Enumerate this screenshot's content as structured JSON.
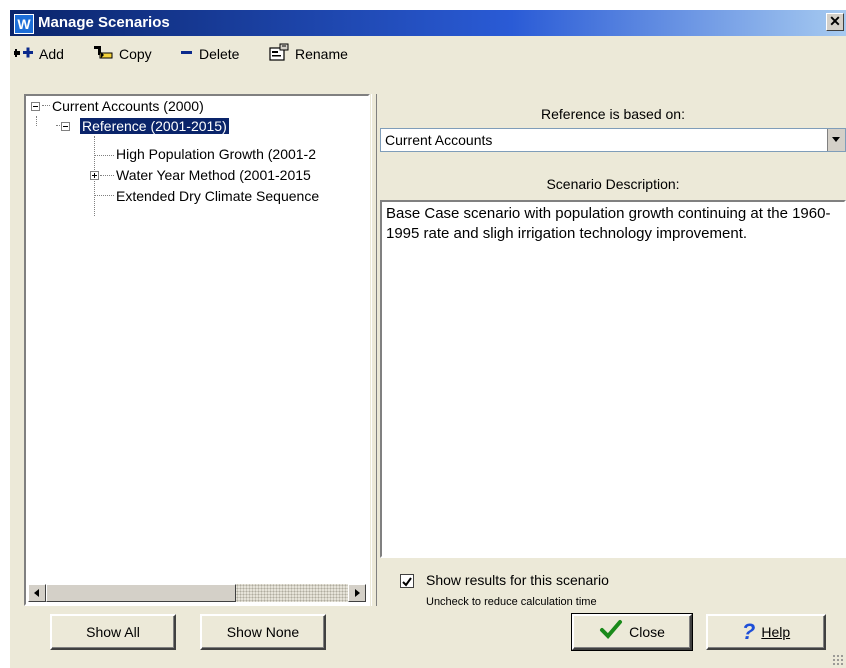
{
  "window": {
    "title": "Manage Scenarios",
    "app_icon_letter": "W",
    "close_glyph": "✕"
  },
  "toolbar": {
    "add_label": "Add",
    "copy_label": "Copy",
    "delete_label": "Delete",
    "rename_label": "Rename"
  },
  "tree": {
    "root": "Current Accounts (2000)",
    "selected": "Reference (2001-2015)",
    "children": [
      "High Population Growth (2001-2",
      "Water Year Method (2001-2015",
      "Extended Dry Climate Sequence"
    ]
  },
  "details": {
    "based_on_label": "Reference is based on:",
    "based_on_value": "Current Accounts",
    "description_label": "Scenario Description:",
    "description": "Base Case scenario with population growth continuing at the 1960-1995 rate and sligh irrigation technology improvement."
  },
  "show_results": {
    "label": "Show results for this scenario",
    "hint": "Uncheck to reduce calculation time",
    "checked": true
  },
  "buttons": {
    "show_all": "Show All",
    "show_none": "Show None",
    "close": "Close",
    "help": "Help"
  },
  "colors": {
    "title_bar": "#0a246a",
    "selection": "#0a246a",
    "check_green": "#1a8a1a",
    "help_blue": "#1e4fd8"
  }
}
